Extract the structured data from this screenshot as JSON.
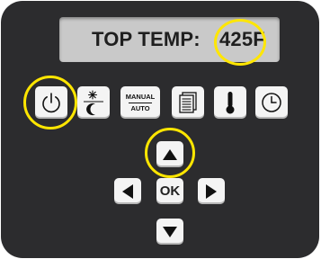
{
  "display": {
    "label": "TOP TEMP:",
    "value": "425F"
  },
  "buttons": {
    "power": {
      "icon": "power-icon"
    },
    "light_mode": {
      "icon": "sun-moon-icon"
    },
    "manual_auto": {
      "top_label": "MANUAL",
      "bottom_label": "AUTO"
    },
    "menu": {
      "icon": "document-list-icon"
    },
    "temperature": {
      "icon": "thermometer-icon"
    },
    "timer": {
      "icon": "clock-icon"
    },
    "ok": {
      "label": "OK"
    },
    "up": {
      "icon": "arrow-up-icon"
    },
    "down": {
      "icon": "arrow-down-icon"
    },
    "left": {
      "icon": "arrow-left-icon"
    },
    "right": {
      "icon": "arrow-right-icon"
    }
  },
  "highlights": [
    "temperature-value",
    "power-button",
    "up-arrow-button"
  ],
  "colors": {
    "panel": "#2c2c2e",
    "screen": "#c9c9c9",
    "key": "#f4f4f4",
    "highlight": "#ffe600"
  }
}
